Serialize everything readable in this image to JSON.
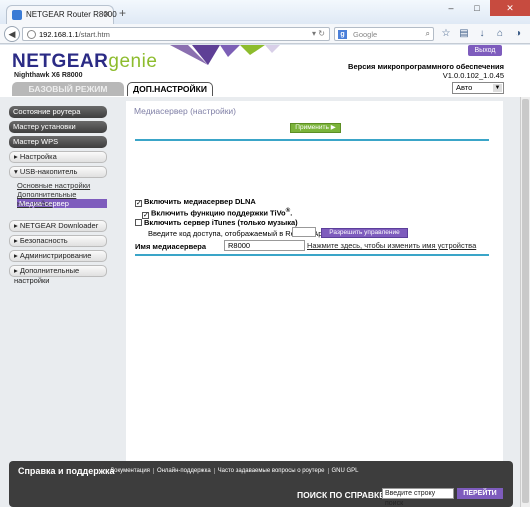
{
  "browser": {
    "tab_title": "NETGEAR Router R8000",
    "tab_close": "✕",
    "new_tab": "+",
    "url_host": "192.168.1.1",
    "url_path": "/start.htm",
    "search_placeholder": "Google",
    "window_min": "–",
    "window_max": "□",
    "window_close": "✕"
  },
  "header": {
    "logo_main": "NETGEAR",
    "logo_genie": "genie",
    "model": "Nighthawk X6 R8000",
    "logout_label": "Выход",
    "firmware_label": "Версия микропрограммного обеспечения",
    "firmware_version": "V1.0.0.102_1.0.45",
    "tab_basic": "БАЗОВЫЙ РЕЖИМ",
    "tab_advanced": "ДОП.НАСТРОЙКИ",
    "language": "Авто"
  },
  "sidebar": {
    "dark_items": [
      "Состояние роутера",
      "Мастер установки",
      "Мастер WPS"
    ],
    "setup": "Настройка",
    "usb": "USB-накопитель",
    "usb_sub": [
      "Основные настройки",
      "Дополнительные настройки",
      "Медиа-сервер"
    ],
    "downloader": "NETGEAR Downloader",
    "security": "Безопасность",
    "admin": "Администрирование",
    "advanced": "Дополнительные настройки"
  },
  "main": {
    "title": "Медиасервер (настройки)",
    "apply_label": "Применить ▶",
    "dlna_label": "Включить медиасервер DLNA",
    "dlna_checked": true,
    "tivo_label": "Включить функцию поддержки TiVo",
    "tivo_sup": "®",
    "tivo_suffix": ".",
    "tivo_checked": true,
    "itunes_label": "Включить сервер iTunes (только музыка)",
    "itunes_checked": false,
    "access_code_label": "Введите код доступа, отображаемый в Remote App",
    "access_code_value": "",
    "allow_label": "Разрешить управление",
    "server_name_label": "Имя медиасервера",
    "server_name_value": "R8000",
    "rename_link": "Нажмите здесь, чтобы изменить имя устройства"
  },
  "footer": {
    "title": "Справка и поддержка",
    "links": [
      "Документация",
      "Онлайн-поддержка",
      "Часто задаваемые вопросы о роутере",
      "GNU GPL"
    ],
    "search_label": "ПОИСК ПО СПРАВКЕ",
    "search_value": "Введите строку поиск",
    "go_label": "ПЕРЕЙТИ"
  },
  "colors": {
    "purple": "#7e5cbd",
    "green": "#7bb33a",
    "teal": "#3aa5c8",
    "navy": "#2b2b85"
  }
}
